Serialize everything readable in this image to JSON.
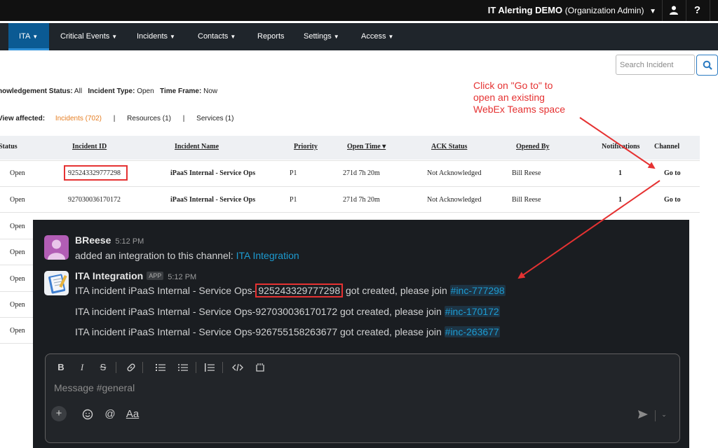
{
  "topbar": {
    "org_name": "IT Alerting DEMO",
    "org_role": "(Organization Admin)",
    "help_label": "?"
  },
  "nav": {
    "items": [
      {
        "label": "ITA"
      },
      {
        "label": "Critical Events"
      },
      {
        "label": "Incidents"
      },
      {
        "label": "Contacts"
      },
      {
        "label": "Reports"
      },
      {
        "label": "Settings"
      },
      {
        "label": "Access"
      }
    ]
  },
  "search": {
    "placeholder": "Search Incident"
  },
  "filters": {
    "ack_label": "nowledgement Status:",
    "ack_value": "All",
    "type_label": "Incident Type:",
    "type_value": "Open",
    "time_label": "Time Frame:",
    "time_value": "Now"
  },
  "view": {
    "label": "View affected:",
    "incidents": "Incidents (702)",
    "resources": "Resources (1)",
    "services": "Services (1)",
    "separator": "|"
  },
  "table": {
    "headers": {
      "status": "Status",
      "incident_id": "Incident ID",
      "incident_name": "Incident Name",
      "priority": "Priority",
      "open_time": "Open Time ▾",
      "ack_status": "ACK Status",
      "opened_by": "Opened By",
      "notifications": "Notifications",
      "channel": "Channel"
    },
    "rows": [
      {
        "status": "Open",
        "incident_id": "925243329777298",
        "incident_name": "iPaaS Internal - Service Ops",
        "priority": "P1",
        "open_time": "271d 7h 20m",
        "ack_status": "Not Acknowledged",
        "opened_by": "Bill Reese",
        "notifications": "1",
        "channel": "Go to"
      },
      {
        "status": "Open",
        "incident_id": "927030036170172",
        "incident_name": "iPaaS Internal - Service Ops",
        "priority": "P1",
        "open_time": "271d 7h 20m",
        "ack_status": "Not Acknowledged",
        "opened_by": "Bill Reese",
        "notifications": "1",
        "channel": "Go to"
      },
      {
        "status": "Open"
      },
      {
        "status": "Open"
      },
      {
        "status": "Open"
      },
      {
        "status": "Open"
      },
      {
        "status": "Open"
      }
    ]
  },
  "annotation": {
    "lines": [
      "Click on \"Go to\" to",
      "open an existing",
      "WebEx Teams space"
    ],
    "color": "#e53232"
  },
  "slack": {
    "messages": [
      {
        "author": "BReese",
        "time": "5:12 PM",
        "text": "added an integration to this channel:",
        "link": "ITA Integration"
      },
      {
        "author": "ITA Integration",
        "badge": "APP",
        "time": "5:12 PM",
        "lines": [
          {
            "prefix": "ITA incident iPaaS Internal - Service Ops-",
            "id": "925243329777298",
            "suffix": " got created, please join ",
            "channel": "#inc-777298"
          },
          {
            "prefix": "ITA incident iPaaS Internal - Service Ops-",
            "id": "927030036170172",
            "suffix": " got created, please join ",
            "channel": "#inc-170172"
          },
          {
            "prefix": "ITA incident iPaaS Internal - Service Ops-",
            "id": "926755158263677",
            "suffix": " got created, please join ",
            "channel": "#inc-263677"
          }
        ]
      }
    ],
    "composer": {
      "placeholder": "Message #general",
      "fmt_bold": "B",
      "fmt_italic": "I",
      "fmt_strike": "S",
      "text_style_label": "Aa"
    }
  }
}
